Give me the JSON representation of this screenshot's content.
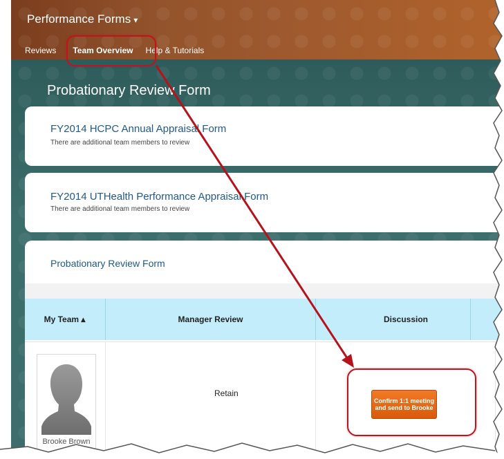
{
  "app": {
    "title": "Performance Forms",
    "title_caret": "▾"
  },
  "nav": {
    "items": [
      "Reviews",
      "Team Overview",
      "Help & Tutorials"
    ]
  },
  "page": {
    "title": "Probationary Review Form"
  },
  "cards": [
    {
      "title": "FY2014 HCPC Annual Appraisal Form",
      "subtitle": "There are additional team members to review"
    },
    {
      "title": "FY2014 UTHealth Performance Appraisal Form",
      "subtitle": "There are additional team members to review"
    }
  ],
  "section": {
    "title": "Probationary Review Form"
  },
  "table": {
    "headers": [
      "My Team ▴",
      "Manager Review",
      "Discussion"
    ],
    "rows": [
      {
        "name": "Brooke Brown",
        "manager_review": "Retain",
        "action": "Confirm 1:1 meeting and send to Brooke"
      }
    ]
  },
  "colors": {
    "banner": "#93532c",
    "teal": "#3c6e6c",
    "header_row": "#c3edfb",
    "button": "#e8681a",
    "highlight": "#c0141c",
    "link": "#1f5a8a"
  }
}
